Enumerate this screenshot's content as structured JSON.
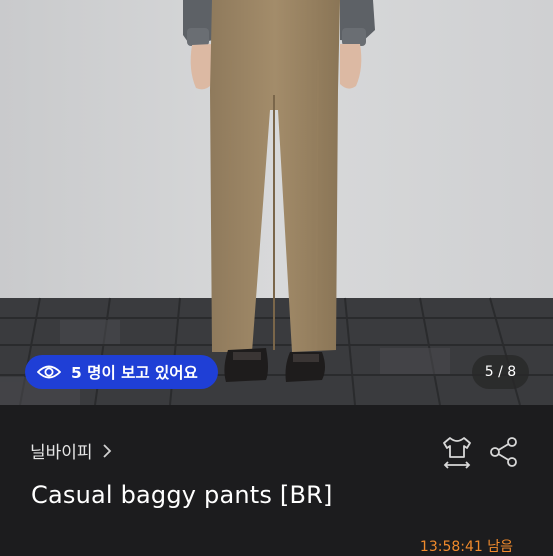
{
  "photo": {
    "viewers_text": "5 명이 보고 있어요",
    "image_counter": "5 / 8"
  },
  "product": {
    "shop_name": "닐바이피",
    "title": "Casual baggy pants [BR]",
    "timer_text": "13:58:41 남음"
  },
  "icons": {
    "viewers": "eye-icon",
    "shop_link": "chevron-right-icon",
    "size_guide": "shirt-size-icon",
    "share": "share-icon"
  },
  "colors": {
    "viewers_pill": "#1f3fd6",
    "timer": "#f08a2c",
    "background": "#1c1c1e"
  }
}
